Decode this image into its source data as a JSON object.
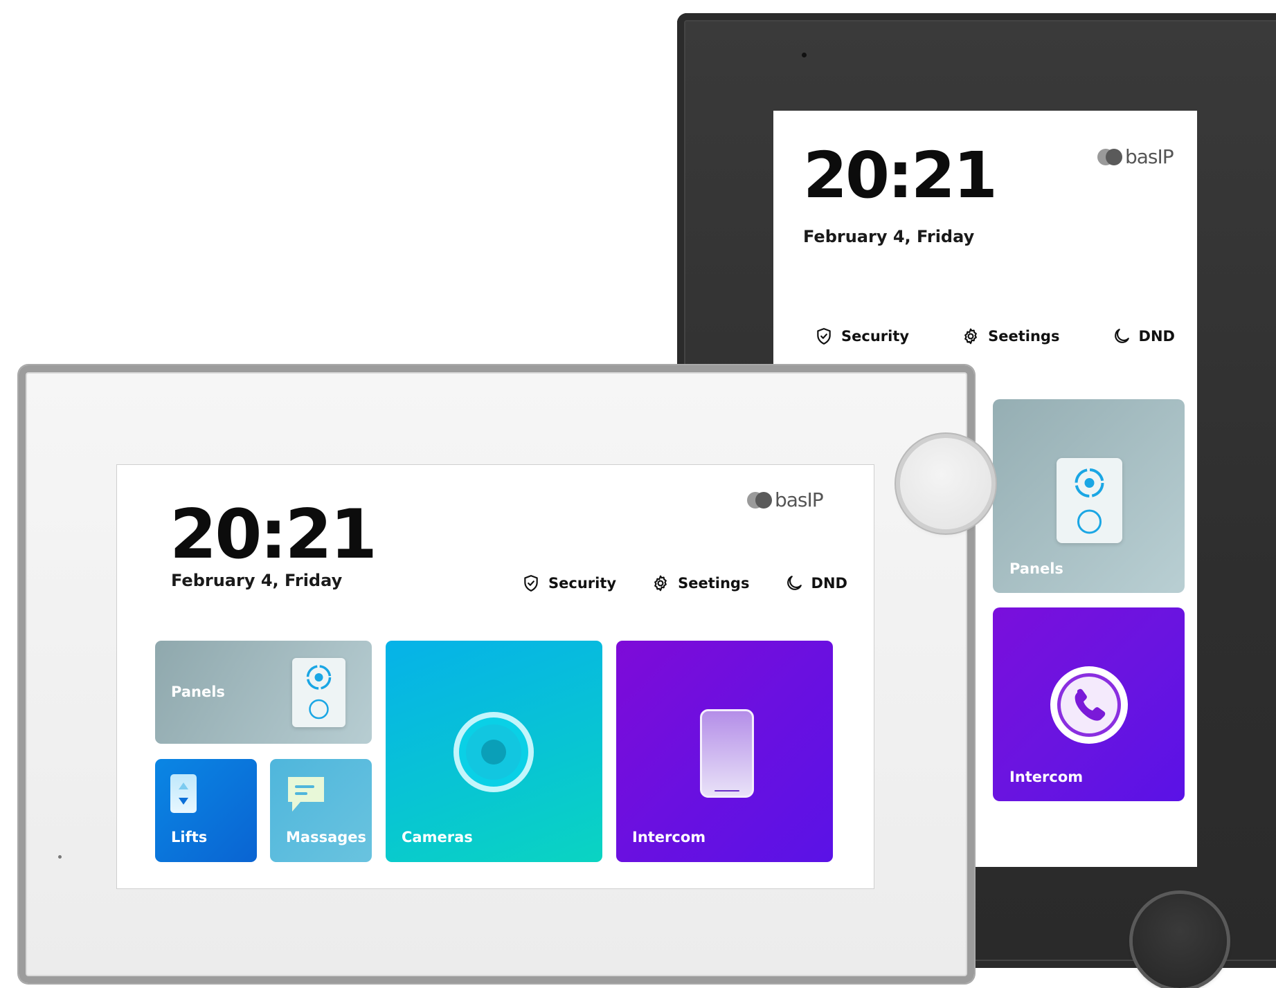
{
  "brand": {
    "name": "basIP",
    "accent": "#0a86e4"
  },
  "portrait_panel": {
    "time": "20:21",
    "date": "February 4, Friday",
    "actions": [
      {
        "label": "Security",
        "icon": "shield-check-icon"
      },
      {
        "label": "Seetings",
        "icon": "gear-icon"
      },
      {
        "label": "DND",
        "icon": "moon-icon"
      }
    ],
    "tiles": {
      "panels": {
        "label": "Panels",
        "icon": "doorbell-panel-icon",
        "color": "#a8c0c5"
      },
      "intercom": {
        "label": "Intercom",
        "icon": "phone-call-icon",
        "color": "#6a10e0"
      }
    }
  },
  "landscape_panel": {
    "time": "20:21",
    "date": "February 4, Friday",
    "actions": [
      {
        "label": "Security",
        "icon": "shield-check-icon"
      },
      {
        "label": "Seetings",
        "icon": "gear-icon"
      },
      {
        "label": "DND",
        "icon": "moon-icon"
      }
    ],
    "tiles": {
      "panels": {
        "label": "Panels",
        "icon": "doorbell-panel-icon",
        "color": "#a3babf"
      },
      "lifts": {
        "label": "Lifts",
        "icon": "elevator-icon",
        "color": "#0a76dc"
      },
      "messages": {
        "label": "Massages",
        "icon": "chat-bubble-icon",
        "color": "#5cbcdd"
      },
      "cameras": {
        "label": "Cameras",
        "icon": "camera-lens-icon",
        "color": "#08c0d6"
      },
      "intercom": {
        "label": "Intercom",
        "icon": "smartphone-icon",
        "color": "#6c10e0"
      }
    }
  }
}
